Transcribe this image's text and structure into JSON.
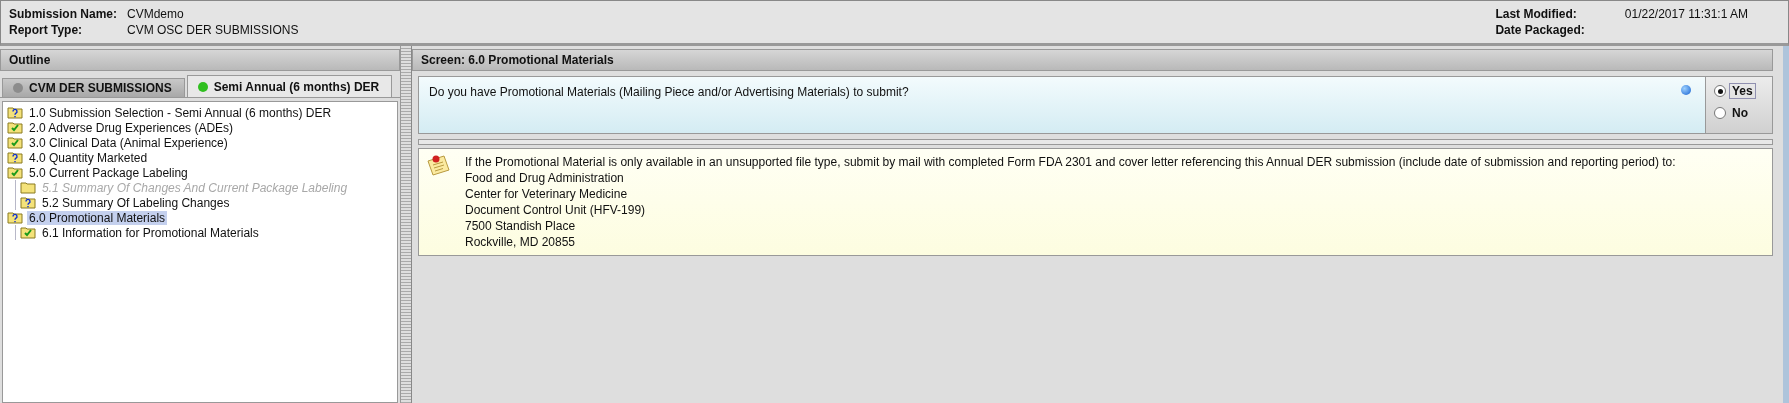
{
  "header": {
    "fields_left": [
      {
        "label": "Submission Name:",
        "value": "CVMdemo"
      },
      {
        "label": "Report Type:",
        "value": "CVM OSC DER SUBMISSIONS"
      }
    ],
    "fields_right": [
      {
        "label": "Last Modified:",
        "value": "01/22/2017 11:31:1 AM"
      },
      {
        "label": "Date Packaged:"
      }
    ]
  },
  "outline": {
    "title": "Outline",
    "tabs": [
      {
        "label": "CVM DER SUBMISSIONS",
        "selected": false,
        "color": "#8c8c8c"
      },
      {
        "label": "Semi Annual (6 months) DER",
        "selected": true,
        "color": "#2fbf1f"
      }
    ],
    "tree": [
      {
        "label": "1.0 Submission Selection - Semi Annual (6 months) DER",
        "kind": "question",
        "selected": false,
        "disabled": false
      },
      {
        "label": "2.0 Adverse Drug Experiences (ADEs)",
        "kind": "check",
        "selected": false,
        "disabled": false
      },
      {
        "label": "3.0 Clinical Data (Animal Experience)",
        "kind": "check",
        "selected": false,
        "disabled": false
      },
      {
        "label": "4.0 Quantity Marketed",
        "kind": "question",
        "selected": false,
        "disabled": false
      },
      {
        "label": "5.0 Current Package Labeling",
        "kind": "check",
        "selected": false,
        "disabled": false,
        "children": [
          {
            "label": "5.1 Summary Of Changes And Current Package Labeling",
            "kind": "empty",
            "selected": false,
            "disabled": true
          },
          {
            "label": "5.2 Summary Of Labeling Changes",
            "kind": "question",
            "selected": false,
            "disabled": false
          }
        ]
      },
      {
        "label": "6.0 Promotional Materials",
        "kind": "question",
        "selected": true,
        "disabled": false,
        "children": [
          {
            "label": "6.1 Information for Promotional Materials",
            "kind": "check",
            "selected": false,
            "disabled": false
          }
        ]
      }
    ]
  },
  "screen": {
    "title": "Screen: 6.0 Promotional Materials",
    "question": {
      "text": "Do you have Promotional Materials (Mailing Piece and/or Advertising Materials) to submit?",
      "options": [
        {
          "label": "Yes",
          "selected": true
        },
        {
          "label": "No",
          "selected": false
        }
      ]
    },
    "note": {
      "lines": [
        "If the Promotional Material is only available in an unsupported file type, submit by mail with completed Form FDA 2301 and cover letter referencing this Annual DER submission (include date of submission and reporting period) to:",
        "Food and Drug Administration",
        "Center for Veterinary Medicine",
        "Document Control Unit (HFV-199)",
        "7500 Standish Place",
        "Rockville, MD 20855"
      ]
    }
  }
}
